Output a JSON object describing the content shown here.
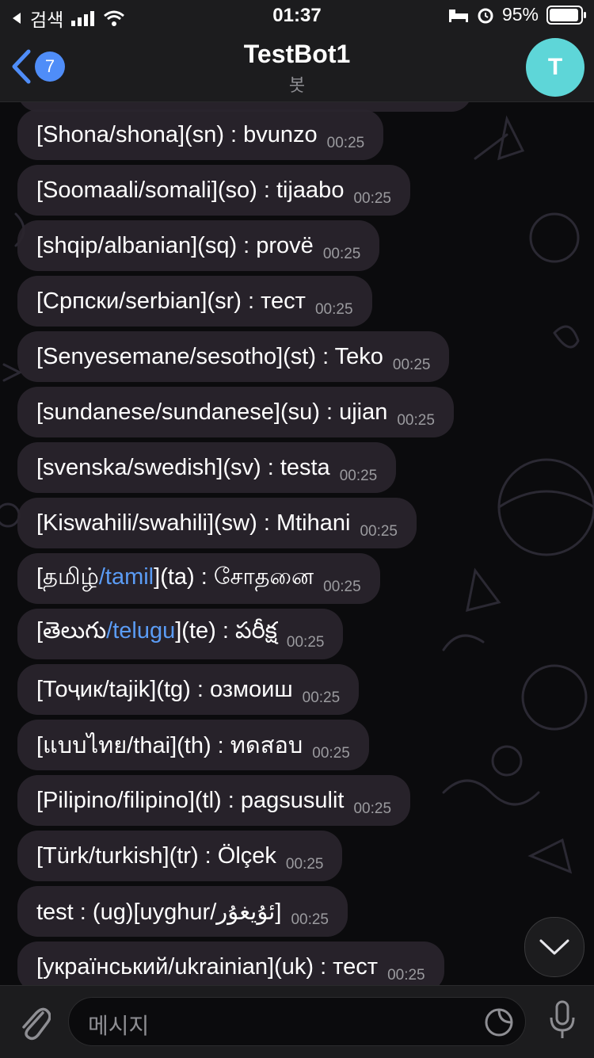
{
  "status_bar": {
    "carrier": "검색",
    "time": "01:37",
    "battery": "95%",
    "battery_level": 0.95
  },
  "header": {
    "back_count": "7",
    "title": "TestBot1",
    "subtitle": "봇",
    "avatar_letter": "T"
  },
  "messages": [
    {
      "parts": [
        {
          "t": "[Shona/shona](sn) : bvunzo"
        }
      ],
      "time": "00:25"
    },
    {
      "parts": [
        {
          "t": "[Soomaali/somali](so) : tijaabo"
        }
      ],
      "time": "00:25"
    },
    {
      "parts": [
        {
          "t": "[shqip/albanian](sq) : provë"
        }
      ],
      "time": "00:25"
    },
    {
      "parts": [
        {
          "t": "[Српски/serbian](sr) : тест"
        }
      ],
      "time": "00:25"
    },
    {
      "parts": [
        {
          "t": "[Senyesemane/sesotho](st) : Teko"
        }
      ],
      "time": "00:25"
    },
    {
      "parts": [
        {
          "t": "[sundanese/sundanese](su) : ujian"
        }
      ],
      "time": "00:25"
    },
    {
      "parts": [
        {
          "t": "[svenska/swedish](sv) : testa"
        }
      ],
      "time": "00:25"
    },
    {
      "parts": [
        {
          "t": "[Kiswahili/swahili](sw) : Mtihani"
        }
      ],
      "time": "00:25"
    },
    {
      "parts": [
        {
          "t": "[தமிழ்"
        },
        {
          "t": "/tamil",
          "link": true
        },
        {
          "t": "](ta) : சோதனை"
        }
      ],
      "time": "00:25"
    },
    {
      "parts": [
        {
          "t": "[తెలుగు"
        },
        {
          "t": "/telugu",
          "link": true
        },
        {
          "t": "](te) : పరీక్ష"
        }
      ],
      "time": "00:25"
    },
    {
      "parts": [
        {
          "t": "[Тоҷик/tajik](tg) : озмоиш"
        }
      ],
      "time": "00:25"
    },
    {
      "parts": [
        {
          "t": "[แบบไทย/thai](th) : ทดสอบ"
        }
      ],
      "time": "00:25"
    },
    {
      "parts": [
        {
          "t": "[Pilipino/filipino](tl) : pagsusulit"
        }
      ],
      "time": "00:25"
    },
    {
      "parts": [
        {
          "t": "[Türk/turkish](tr) : Ölçek"
        }
      ],
      "time": "00:25"
    },
    {
      "parts": [
        {
          "t": "test : (ug)[uyghur/ئۇيغۇر]"
        }
      ],
      "time": "00:25"
    },
    {
      "parts": [
        {
          "t": "[український/ukrainian](uk) : тест"
        }
      ],
      "time": "00:25"
    }
  ],
  "input": {
    "placeholder": "메시지"
  },
  "icons": {
    "back": "chevron-left-icon",
    "signal": "signal-icon",
    "wifi": "wifi-icon",
    "bed": "bed-icon",
    "alarm": "alarm-icon",
    "battery": "battery-icon",
    "attach": "paperclip-icon",
    "sticker": "sticker-icon",
    "mic": "microphone-icon",
    "scroll": "chevron-down-icon"
  },
  "colors": {
    "accent": "#4f8df8",
    "link": "#5b9cf5",
    "avatar": "#5ed6d8",
    "bubble": "#2a252d"
  }
}
